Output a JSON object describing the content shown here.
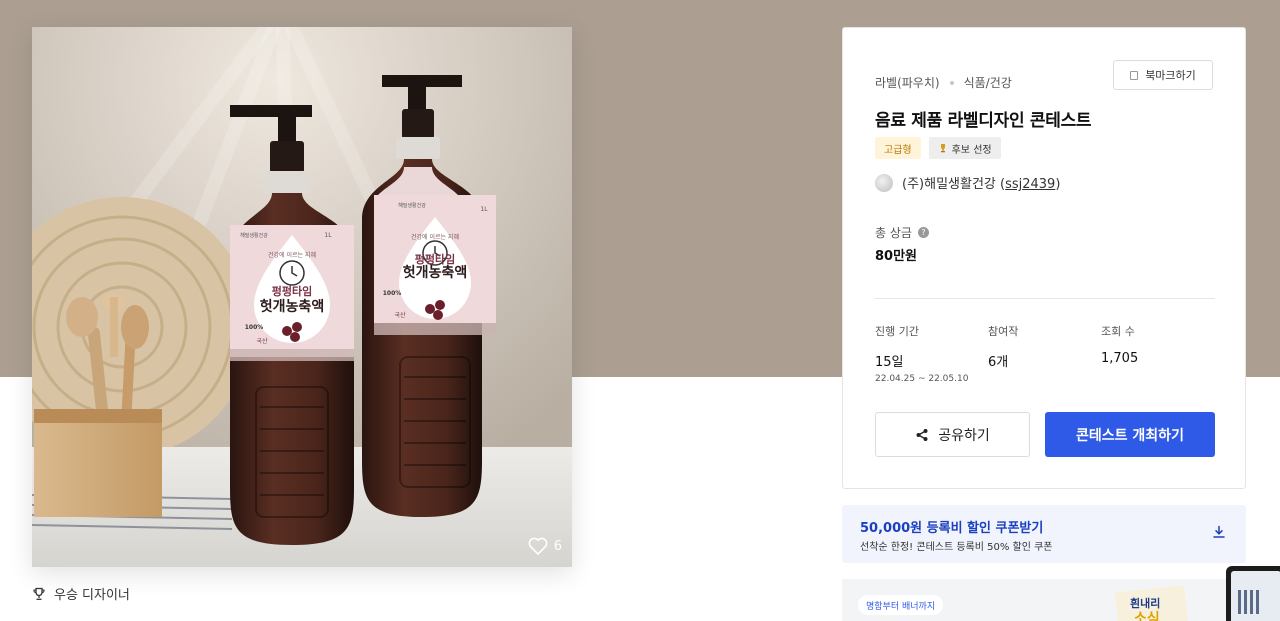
{
  "hero": {
    "like_count": "6",
    "bottle_front": {
      "brand": "해밀생활건강",
      "name_top": "펑펑타임",
      "name_main": "헛개농축액",
      "tagline": "건강에 이르는 지혜",
      "badge_100": "100%",
      "badge_origin": "국산",
      "volume": "1L"
    },
    "bottle_back": {
      "brand": "해밀생활건강",
      "name_top": "펑펑타임",
      "name_main": "헛개농축액",
      "tagline": "건강에 이르는 지혜",
      "badge_100": "100%",
      "badge_origin": "국산",
      "volume": "1L"
    }
  },
  "award_label": "우승 디자이너",
  "card": {
    "category_1": "라벨(파우치)",
    "category_2": "식품/건강",
    "bookmark_label": "북마크하기",
    "title": "음료 제품 라벨디자인 콘테스트",
    "badge_premium": "고급형",
    "badge_candidate": "후보 선정",
    "host_name": "(주)해밀생활건강 (",
    "host_id": "ssj2439",
    "host_close": ")",
    "prize_label": "총 상금",
    "prize_value": "80만원",
    "period_label": "진행 기간",
    "period_value": "15일",
    "period_range": "22.04.25  ~  22.05.10",
    "participants_label": "참여작",
    "participants_value": "6개",
    "views_label": "조회 수",
    "views_value": "1,705",
    "share_label": "공유하기",
    "host_button_label": "콘테스트 개최하기"
  },
  "coupon": {
    "title": "50,000원 등록비 할인 쿠폰받기",
    "subtitle": "선착순 한정! 콘테스트 등록비 50% 할인 쿠폰"
  },
  "banner": {
    "pill": "명함부터 배너까지",
    "mock_text_1": "흰내리",
    "mock_text_2": "소식"
  },
  "colors": {
    "accent": "#2f5ae7",
    "top_band": "#ac9f92",
    "coupon_bg": "#f1f4fd"
  }
}
